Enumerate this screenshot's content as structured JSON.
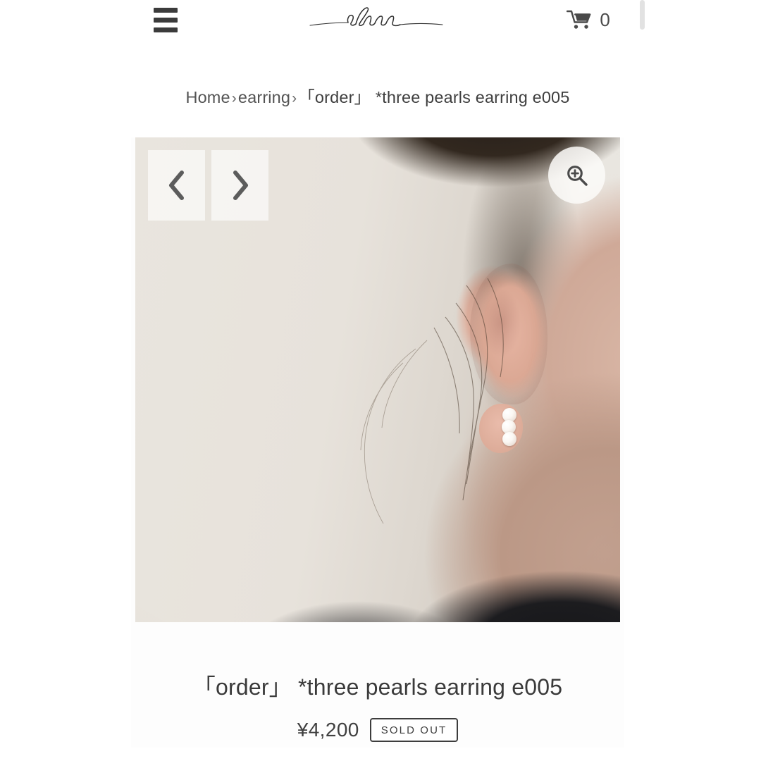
{
  "header": {
    "menu_icon": "hamburger-menu-icon",
    "logo_text": "uluu",
    "logo_icon": "uluu-script-logo",
    "cart_icon": "shopping-cart-icon",
    "cart_count": "0"
  },
  "breadcrumb": {
    "home_label": "Home",
    "separator": "›",
    "category_label": "earring",
    "current_label": "「order」 *three pearls earring e005"
  },
  "gallery": {
    "prev_icon": "chevron-left-icon",
    "next_icon": "chevron-right-icon",
    "zoom_icon": "magnifier-plus-icon",
    "image_alt": "model wearing three pearls earring on ear"
  },
  "product": {
    "title": "「order」 *three pearls earring e005",
    "price": "¥4,200",
    "availability_badge": "SOLD OUT"
  },
  "scrollbar": {
    "orientation": "vertical"
  },
  "colors": {
    "text_primary": "#3a3a3a",
    "text_muted": "#545454",
    "badge_border": "#3d3d3d",
    "page_background": "#ffffff",
    "scrollbar_thumb": "#e2e2e2"
  }
}
